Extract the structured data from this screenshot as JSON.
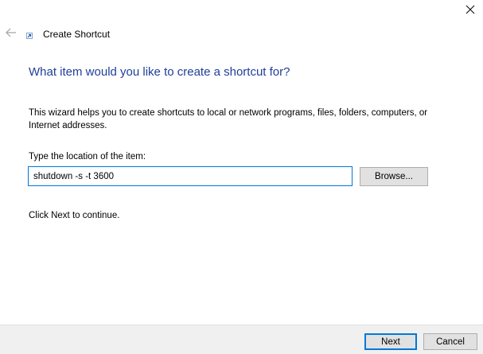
{
  "window": {
    "title": "Create Shortcut",
    "icons": {
      "back": "back-arrow-icon",
      "app": "shortcut-icon",
      "close": "close-icon"
    }
  },
  "main": {
    "heading": "What item would you like to create a shortcut for?",
    "description": "This wizard helps you to create shortcuts to local or network programs, files, folders, computers, or Internet addresses.",
    "location_label": "Type the location of the item:",
    "location_value": "shutdown -s -t 3600",
    "browse_label": "Browse...",
    "continue_text": "Click Next to continue."
  },
  "footer": {
    "next_label": "Next",
    "cancel_label": "Cancel"
  },
  "colors": {
    "heading": "#1f3f99",
    "focus_border": "#0078d7",
    "button_face": "#e1e1e1",
    "footer_bg": "#f0f0f0"
  }
}
